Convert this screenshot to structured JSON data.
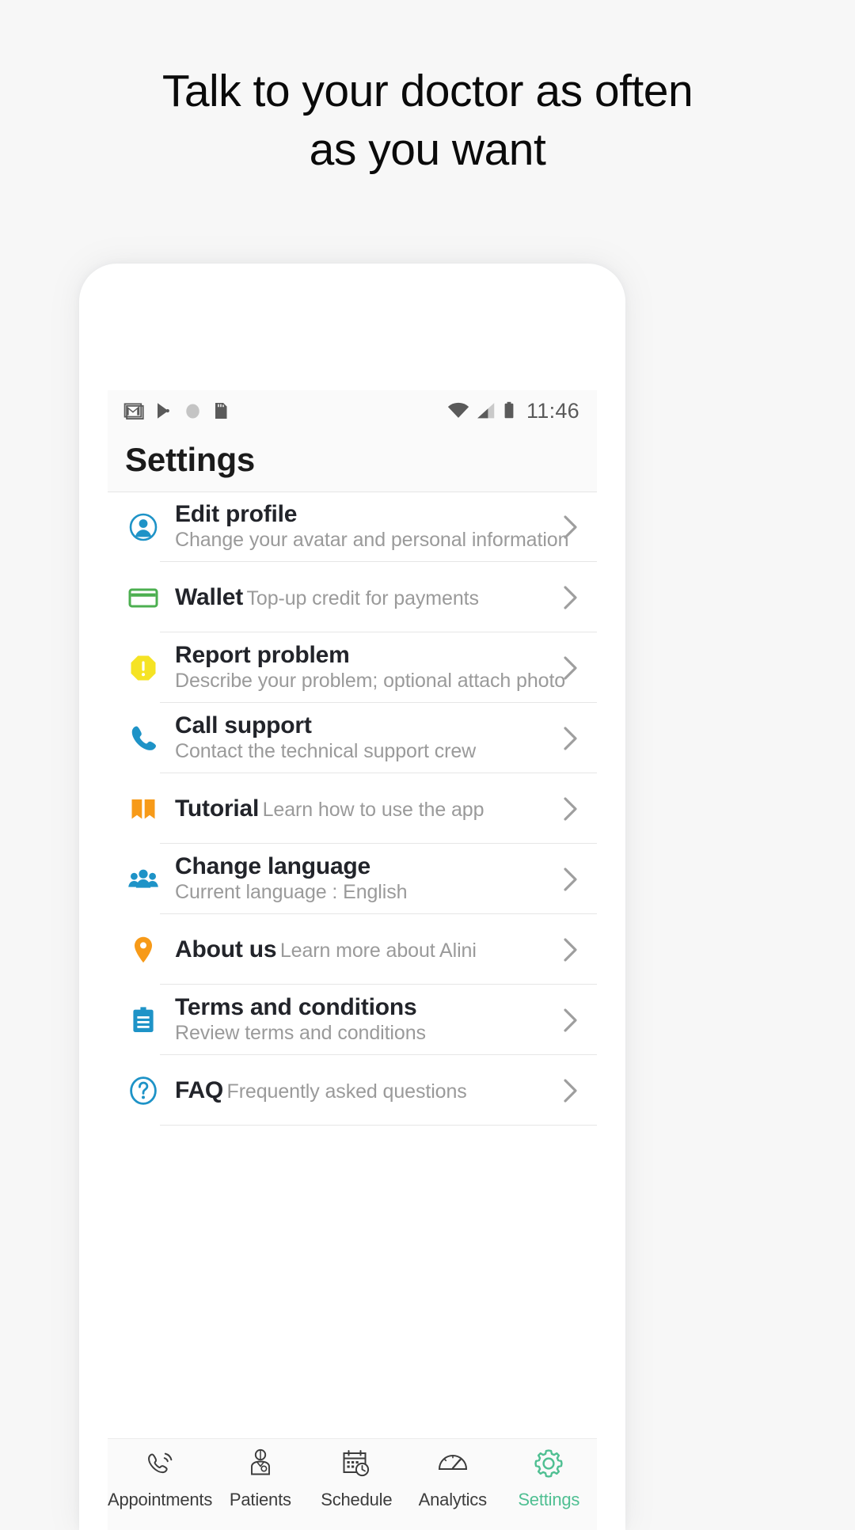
{
  "promo": {
    "line1": "Talk to your doctor as often",
    "line2": "as you want"
  },
  "statusbar": {
    "time": "11:46",
    "left_icons": [
      "gmail-icon",
      "play-store-icon",
      "circle-icon",
      "sd-card-icon"
    ],
    "right_icons": [
      "wifi-icon",
      "cellular-signal-icon",
      "battery-icon"
    ]
  },
  "header": {
    "title": "Settings"
  },
  "settings": {
    "items": [
      {
        "title": "Edit profile",
        "subtitle": "Change your avatar and personal information",
        "icon": "person-circle-icon",
        "color": "#1e93c7"
      },
      {
        "title": "Wallet",
        "subtitle": "Top-up credit for payments",
        "icon": "credit-card-icon",
        "color": "#4caf50"
      },
      {
        "title": "Report problem",
        "subtitle": "Describe your problem; optional attach photo",
        "icon": "warning-octagon-icon",
        "color": "#f5e324"
      },
      {
        "title": "Call support",
        "subtitle": "Contact the technical support crew",
        "icon": "phone-icon",
        "color": "#1e93c7"
      },
      {
        "title": "Tutorial",
        "subtitle": "Learn how to use the app",
        "icon": "open-book-icon",
        "color": "#f79a18"
      },
      {
        "title": "Change language",
        "subtitle": "Current language : English",
        "icon": "people-group-icon",
        "color": "#1e93c7"
      },
      {
        "title": "About us",
        "subtitle": "Learn more about Alini",
        "icon": "map-pin-icon",
        "color": "#f79a18"
      },
      {
        "title": "Terms and conditions",
        "subtitle": "Review terms and conditions",
        "icon": "clipboard-icon",
        "color": "#1e93c7"
      },
      {
        "title": "FAQ",
        "subtitle": "Frequently asked questions",
        "icon": "question-circle-icon",
        "color": "#1e93c7"
      }
    ],
    "chevron_icon": "chevron-right-icon"
  },
  "bottom_nav": {
    "active_color": "#4fbf92",
    "inactive_color": "#3c3c3c",
    "items": [
      {
        "label": "Appointments",
        "icon": "phone-ring-icon",
        "active": false
      },
      {
        "label": "Patients",
        "icon": "doctor-icon",
        "active": false
      },
      {
        "label": "Schedule",
        "icon": "calendar-clock-icon",
        "active": false
      },
      {
        "label": "Analytics",
        "icon": "gauge-icon",
        "active": false
      },
      {
        "label": "Settings",
        "icon": "gear-icon",
        "active": true
      }
    ]
  }
}
